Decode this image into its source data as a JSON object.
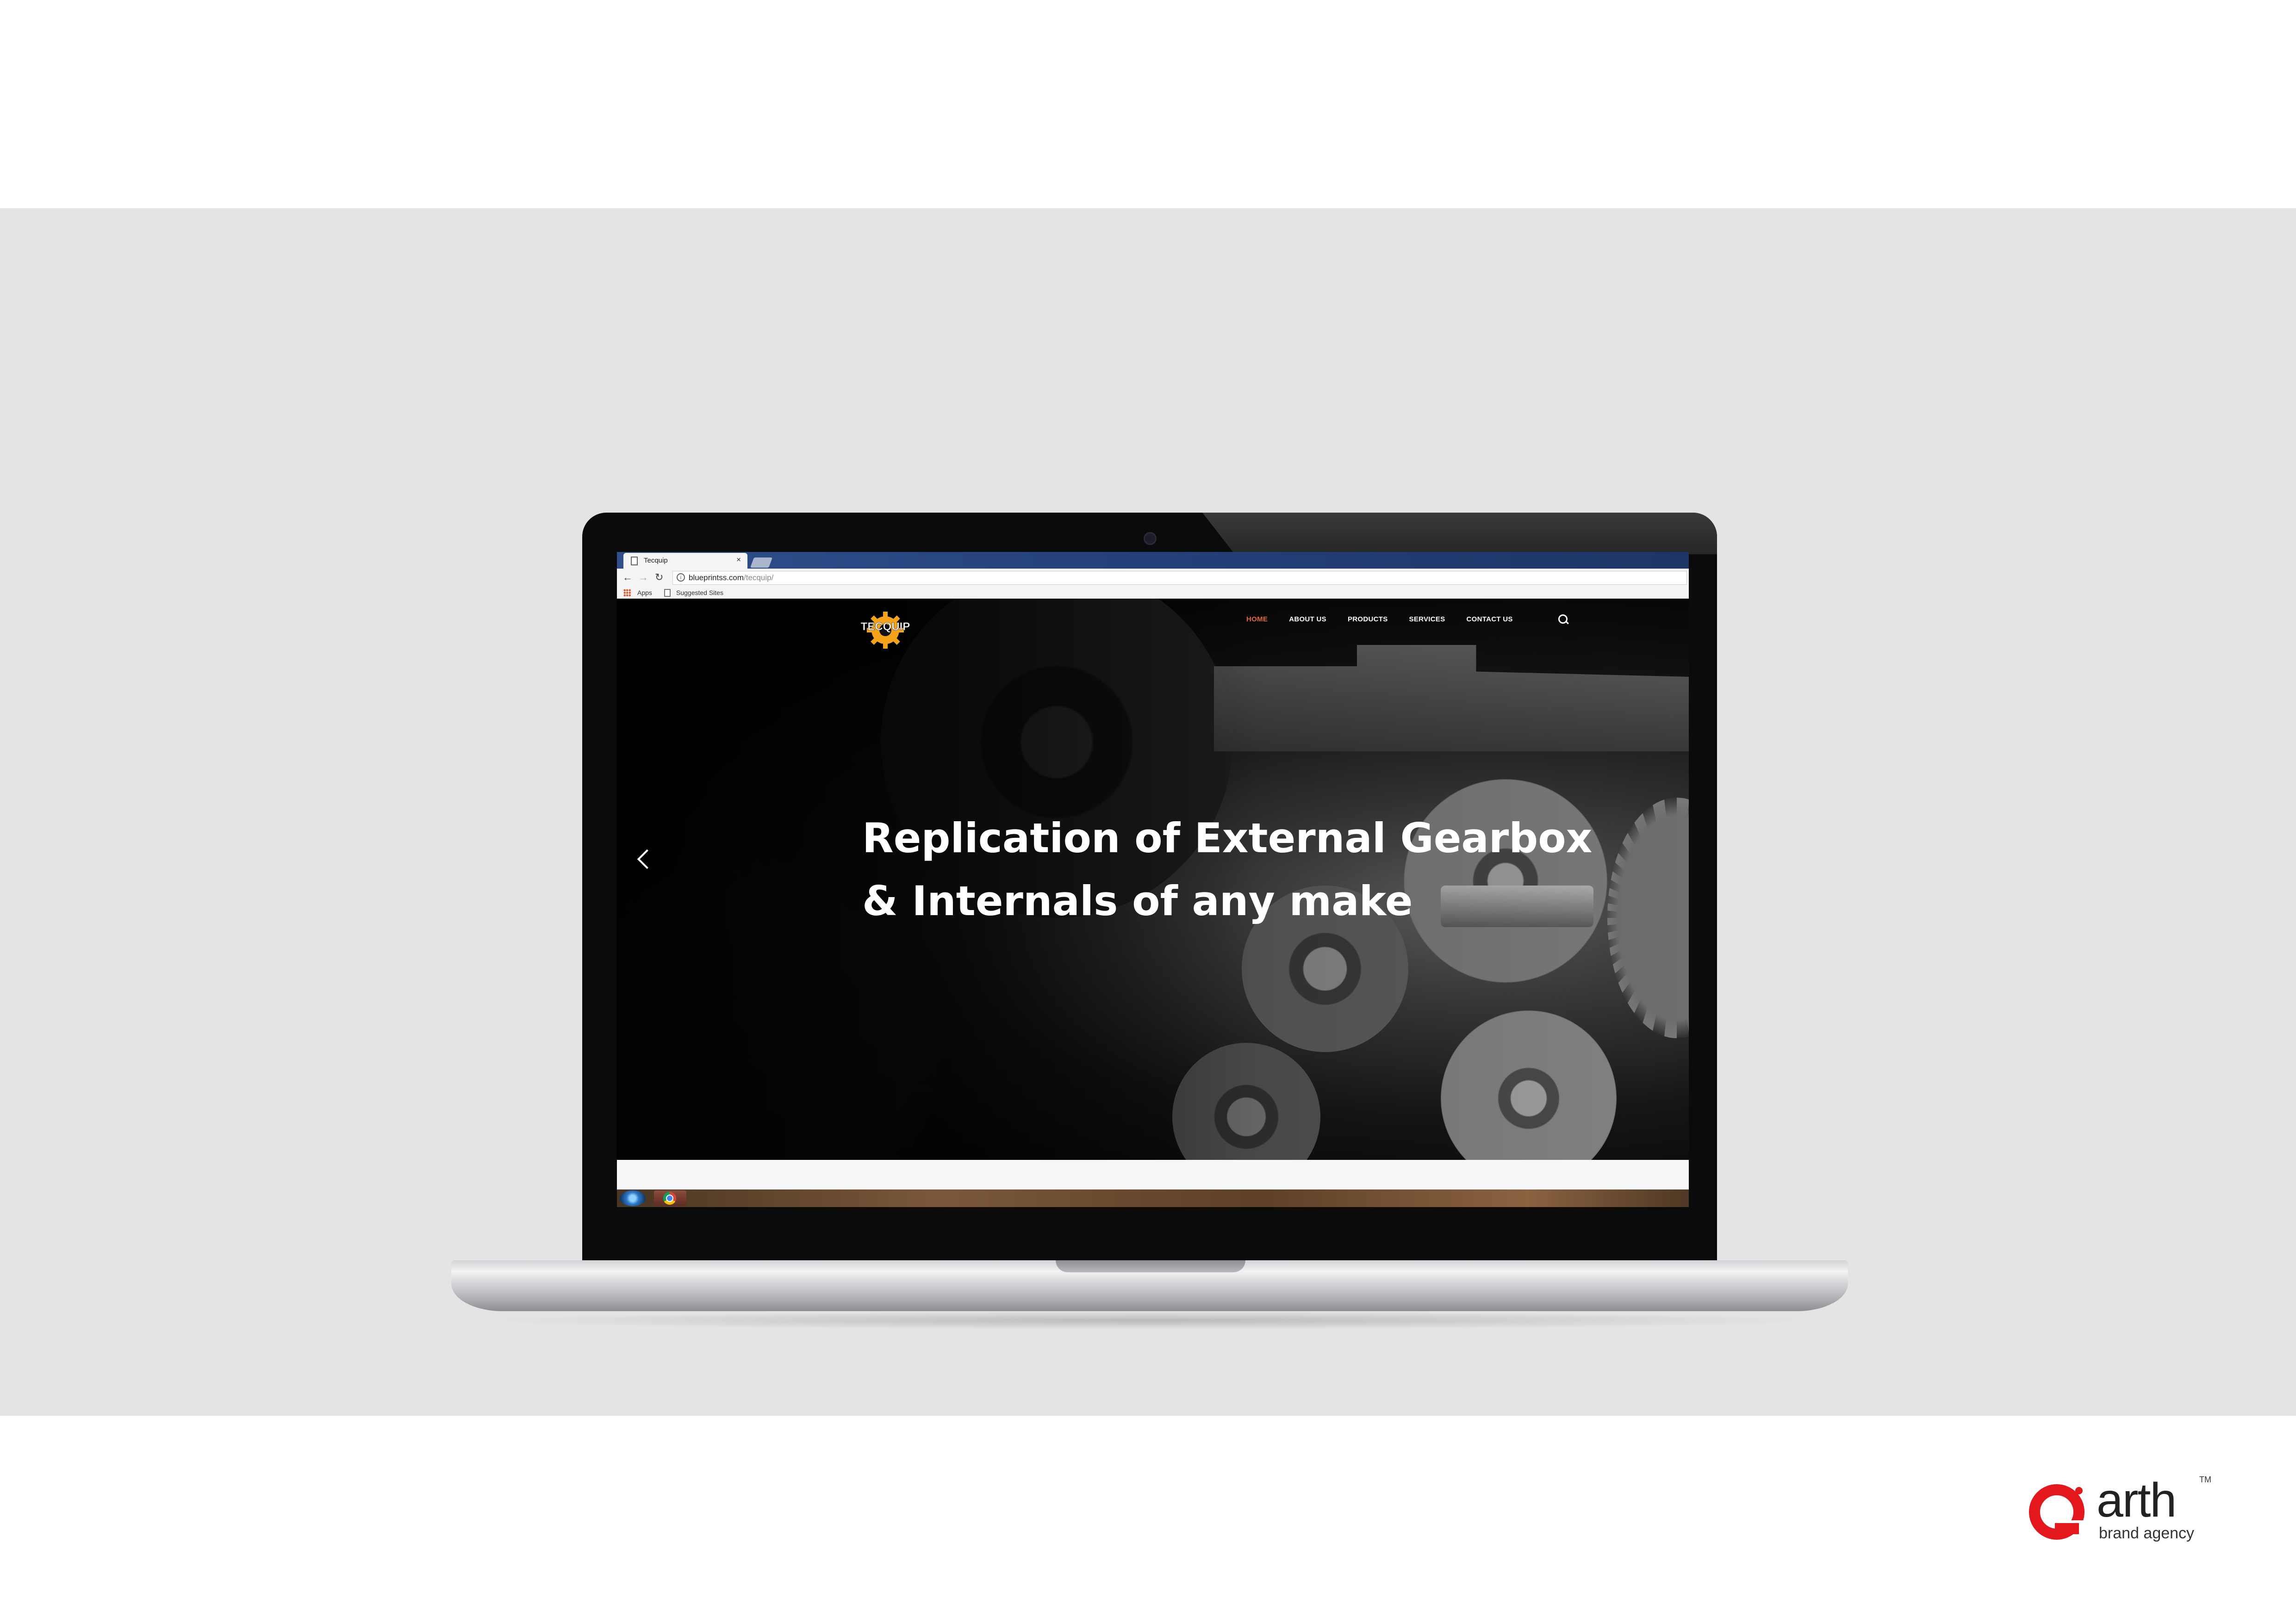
{
  "browser": {
    "tab_title": "Tecquip",
    "tab_close": "×",
    "url_host": "blueprintss.com",
    "url_path": "/tecquip/",
    "bookmarks": {
      "apps": "Apps",
      "suggested": "Suggested Sites"
    },
    "icons": [
      "back-arrow-icon",
      "forward-arrow-icon",
      "reload-icon",
      "info-icon",
      "apps-grid-icon",
      "page-icon"
    ]
  },
  "site": {
    "logo_text": "TECQUIP",
    "nav": [
      {
        "label": "HOME",
        "active": true
      },
      {
        "label": "ABOUT US"
      },
      {
        "label": "PRODUCTS"
      },
      {
        "label": "SERVICES"
      },
      {
        "label": "CONTACT US"
      }
    ],
    "hero": {
      "line1": "Replication of External Gearbox",
      "line2": "& Internals of any make"
    },
    "accent_color": "#e2672c",
    "logo_color": "#f5a21b"
  },
  "brand": {
    "word": "arth",
    "tagline": "brand agency",
    "tm": "TM",
    "color": "#e3171c"
  }
}
